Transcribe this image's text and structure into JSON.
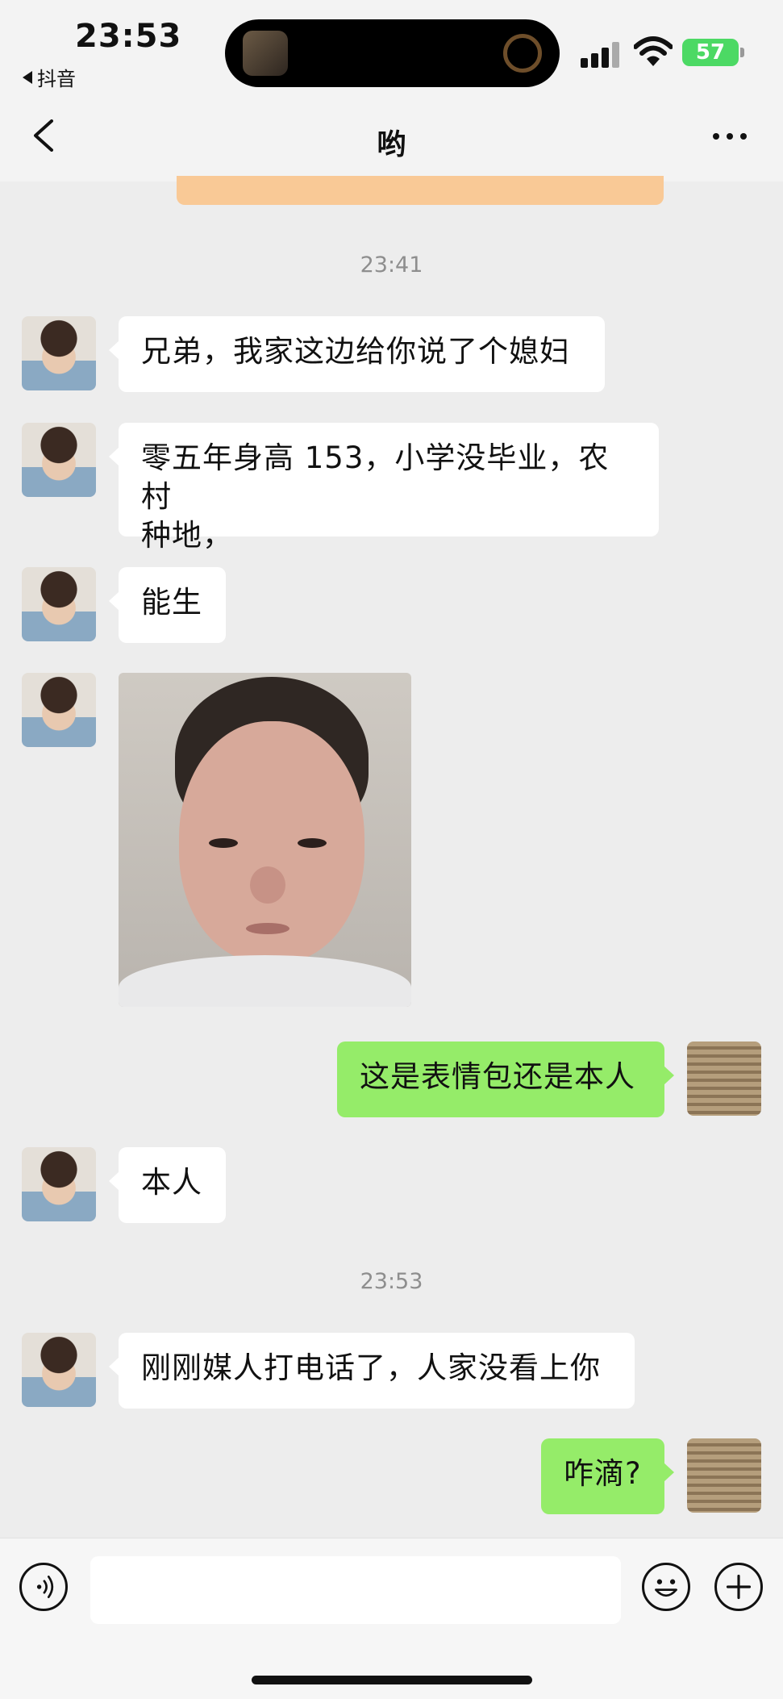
{
  "status_bar": {
    "time": "23:53",
    "back_app": "抖音",
    "battery": "57"
  },
  "nav": {
    "title": "哟"
  },
  "timestamps": [
    "23:41",
    "23:53"
  ],
  "messages": [
    {
      "from": "friend",
      "type": "text",
      "text": "兄弟，我家这边给你说了个媳妇"
    },
    {
      "from": "friend",
      "type": "text",
      "line1": "零五年身高 153，小学没毕业，农村",
      "line2": "种地，"
    },
    {
      "from": "friend",
      "type": "text",
      "text": "能生"
    },
    {
      "from": "friend",
      "type": "image",
      "icon": "photo-of-woman"
    },
    {
      "from": "me",
      "type": "text",
      "text": "这是表情包还是本人"
    },
    {
      "from": "friend",
      "type": "text",
      "text": "本人"
    },
    {
      "from": "friend",
      "type": "text",
      "text": "刚刚媒人打电话了，人家没看上你"
    },
    {
      "from": "me",
      "type": "text",
      "text": "咋滴?"
    }
  ],
  "input_bar": {
    "value": "",
    "icons": [
      "voice-icon",
      "emoji-icon",
      "plus-icon"
    ]
  },
  "colors": {
    "background": "#ededed",
    "incoming_bubble": "#ffffff",
    "outgoing_bubble": "#95ec69",
    "battery": "#4cd964"
  }
}
